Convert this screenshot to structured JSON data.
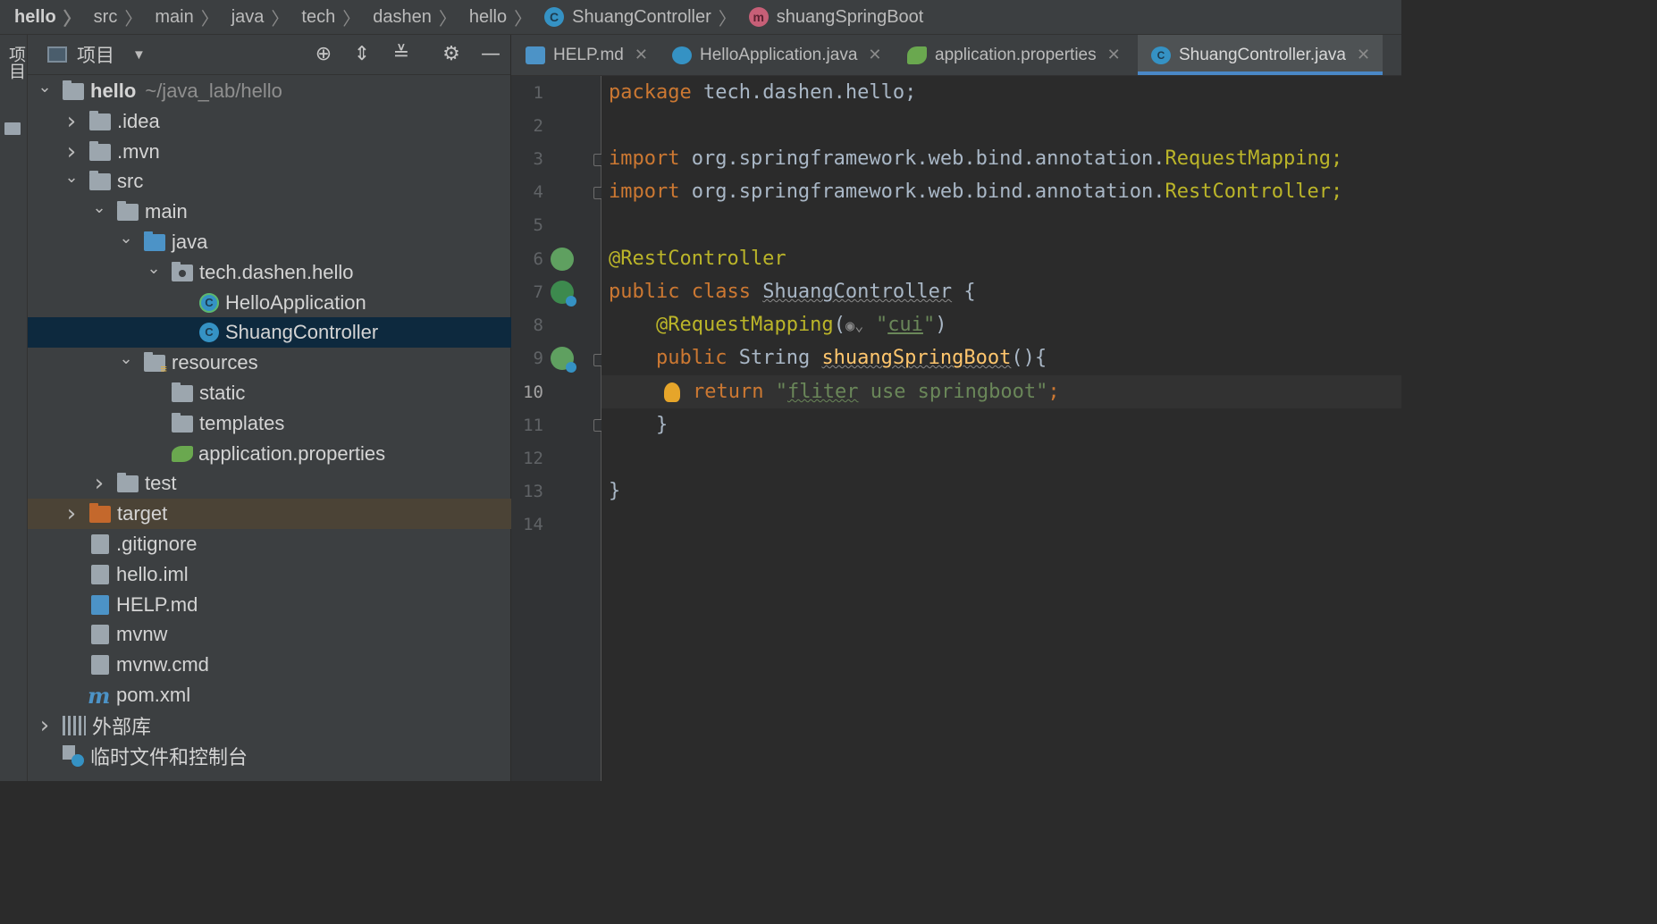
{
  "breadcrumb": {
    "items": [
      "hello",
      "src",
      "main",
      "java",
      "tech",
      "dashen",
      "hello",
      "ShuangController",
      "shuangSpringBoot"
    ],
    "class_badge": "C",
    "method_badge": "m"
  },
  "side_strip": {
    "label": "项目"
  },
  "project_panel": {
    "title": "项目",
    "toolbar_icons": [
      "locate-icon",
      "expand-all-icon",
      "collapse-all-icon",
      "settings-icon",
      "hide-icon"
    ],
    "tree": [
      {
        "name": "hello",
        "extra": "~/java_lab/hello",
        "depth": 0,
        "state": "expanded",
        "icon": "module-folder-icon"
      },
      {
        "name": ".idea",
        "depth": 1,
        "state": "collapsed",
        "icon": "folder-icon"
      },
      {
        "name": ".mvn",
        "depth": 1,
        "state": "collapsed",
        "icon": "folder-icon"
      },
      {
        "name": "src",
        "depth": 1,
        "state": "expanded",
        "icon": "folder-icon"
      },
      {
        "name": "main",
        "depth": 2,
        "state": "expanded",
        "icon": "folder-icon"
      },
      {
        "name": "java",
        "depth": 3,
        "state": "expanded",
        "icon": "source-folder-icon"
      },
      {
        "name": "tech.dashen.hello",
        "depth": 4,
        "state": "expanded",
        "icon": "package-icon"
      },
      {
        "name": "HelloApplication",
        "depth": 5,
        "icon": "spring-app-class-icon"
      },
      {
        "name": "ShuangController",
        "depth": 5,
        "icon": "class-icon",
        "selected": true
      },
      {
        "name": "resources",
        "depth": 3,
        "state": "expanded",
        "icon": "resources-folder-icon"
      },
      {
        "name": "static",
        "depth": 4,
        "icon": "folder-icon"
      },
      {
        "name": "templates",
        "depth": 4,
        "icon": "folder-icon"
      },
      {
        "name": "application.properties",
        "depth": 4,
        "icon": "spring-properties-icon"
      },
      {
        "name": "test",
        "depth": 2,
        "state": "collapsed",
        "icon": "folder-icon"
      },
      {
        "name": "target",
        "depth": 1,
        "state": "collapsed",
        "icon": "excluded-folder-icon",
        "excluded": true
      },
      {
        "name": ".gitignore",
        "depth": 1,
        "icon": "gitignore-file-icon"
      },
      {
        "name": "hello.iml",
        "depth": 1,
        "icon": "iml-file-icon"
      },
      {
        "name": "HELP.md",
        "depth": 1,
        "icon": "markdown-file-icon"
      },
      {
        "name": "mvnw",
        "depth": 1,
        "icon": "shell-file-icon"
      },
      {
        "name": "mvnw.cmd",
        "depth": 1,
        "icon": "text-file-icon"
      },
      {
        "name": "pom.xml",
        "depth": 1,
        "icon": "maven-icon"
      },
      {
        "name": "外部库",
        "depth": 0,
        "state": "collapsed",
        "icon": "libraries-icon"
      },
      {
        "name": "临时文件和控制台",
        "depth": 0,
        "icon": "scratches-icon"
      }
    ]
  },
  "tabs": [
    {
      "label": "HELP.md",
      "icon": "markdown-file-icon",
      "active": false
    },
    {
      "label": "HelloApplication.java",
      "icon": "spring-app-class-icon",
      "active": false
    },
    {
      "label": "application.properties",
      "icon": "spring-properties-icon",
      "active": false
    },
    {
      "label": "ShuangController.java",
      "icon": "class-icon",
      "active": true
    }
  ],
  "editor": {
    "current_line": 10,
    "line_numbers": [
      "1",
      "2",
      "3",
      "4",
      "5",
      "6",
      "7",
      "8",
      "9",
      "10",
      "11",
      "12",
      "13",
      "14"
    ],
    "code": {
      "l1_kw": "package",
      "l1_rest": " tech.dashen.hello;",
      "l3_kw": "import",
      "l3_pkg": " org.springframework.web.bind.annotation.",
      "l3_cls": "RequestMapping;",
      "l4_kw": "import",
      "l4_pkg": " org.springframework.web.bind.annotation.",
      "l4_cls": "RestController;",
      "l6_ann": "@RestController",
      "l7_kw": "public class ",
      "l7_name": "ShuangController",
      "l7_rest": " {",
      "l8_ann": "@RequestMapping",
      "l8_open": "(",
      "l8_str_open": "\"",
      "l8_str": "cui",
      "l8_str_close": "\"",
      "l8_close": ")",
      "l9_kw": "public ",
      "l9_type": "String ",
      "l9_fn": "shuangSpringBoot",
      "l9_rest": "(){",
      "l10_kw": "return ",
      "l10_str_open": "\"",
      "l10_str_word": "fliter",
      "l10_str_rest": " use springboot\"",
      "l10_end": ";",
      "l11": "}",
      "l13": "}"
    }
  }
}
